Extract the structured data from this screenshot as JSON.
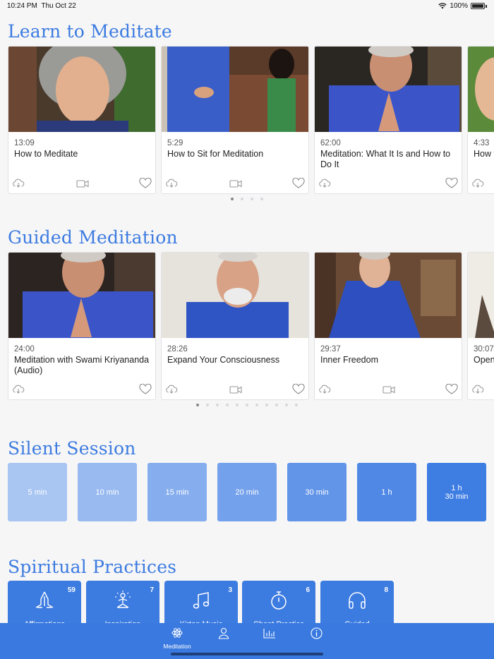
{
  "status_bar": {
    "time": "10:24 PM",
    "date": "Thu Oct 22",
    "battery": "100%"
  },
  "learn": {
    "title": "Learn to Meditate",
    "cards": [
      {
        "duration": "13:09",
        "title": "How to Meditate",
        "video": true
      },
      {
        "duration": "5:29",
        "title": "How to Sit for Meditation",
        "video": true
      },
      {
        "duration": "62:00",
        "title": "Meditation: What It Is and How to Do It",
        "video": false
      },
      {
        "duration": "4:33",
        "title": "How to Practice Kriya",
        "video": false
      }
    ],
    "page_count": 4,
    "page_index": 0
  },
  "guided": {
    "title": "Guided Meditation",
    "cards": [
      {
        "duration": "24:00",
        "title": "Meditation with Swami Kriyananda (Audio)",
        "video": false
      },
      {
        "duration": "28:26",
        "title": "Expand Your Consciousness",
        "video": true
      },
      {
        "duration": "29:37",
        "title": "Inner Freedom",
        "video": true
      },
      {
        "duration": "30:07",
        "title": "Open",
        "video": false
      }
    ],
    "page_count": 11,
    "page_index": 0
  },
  "silent": {
    "title": "Silent Session",
    "tiles": [
      {
        "label": "5 min",
        "color": "#a9c6f2"
      },
      {
        "label": "10 min",
        "color": "#98baf0"
      },
      {
        "label": "15 min",
        "color": "#86aeee"
      },
      {
        "label": "20 min",
        "color": "#74a1eb"
      },
      {
        "label": "30 min",
        "color": "#6295e8"
      },
      {
        "label": "1 h",
        "color": "#5089e5"
      },
      {
        "label": "1 h\n30 min",
        "color": "#3e7de2"
      }
    ]
  },
  "practices": {
    "title": "Spiritual Practices",
    "items": [
      {
        "label": "Affirmations",
        "count": "59",
        "icon": "praying-hands-icon"
      },
      {
        "label": "Inspiration",
        "count": "7",
        "icon": "meditator-icon"
      },
      {
        "label": "Kirtan Music",
        "count": "3",
        "icon": "music-note-icon"
      },
      {
        "label": "Chant Practice",
        "count": "6",
        "icon": "stopwatch-icon"
      },
      {
        "label": "Guided",
        "count": "8",
        "icon": "headphones-icon"
      }
    ]
  },
  "tab_bar": {
    "tabs": [
      {
        "label": "Meditation",
        "icon": "atom-icon"
      },
      {
        "label": "",
        "icon": "profile-icon"
      },
      {
        "label": "",
        "icon": "stats-icon"
      },
      {
        "label": "",
        "icon": "info-icon"
      }
    ]
  }
}
